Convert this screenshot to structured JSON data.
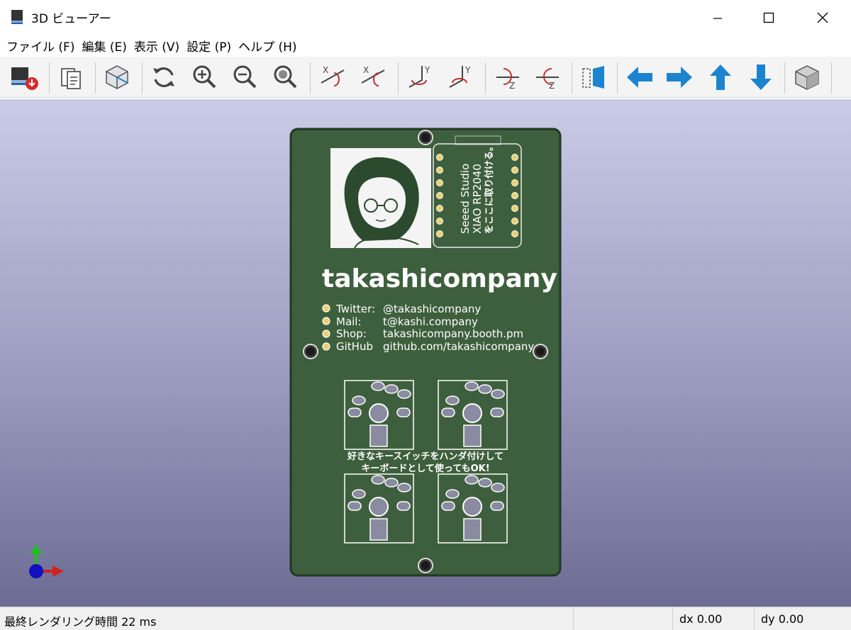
{
  "window": {
    "title": "3D ビューアー"
  },
  "menu": [
    "ファイル (F)",
    "編集 (E)",
    "表示 (V)",
    "設定 (P)",
    "ヘルプ (H)"
  ],
  "toolbar": {
    "buttons": [
      {
        "name": "render-raytracing",
        "icon": "board-render-icon"
      },
      {
        "name": "copy-image",
        "icon": "copy-icon"
      },
      {
        "name": "toggle-view",
        "icon": "view-box-icon"
      },
      {
        "name": "reload",
        "icon": "refresh-icon"
      },
      {
        "name": "zoom-in",
        "icon": "zoom-in-icon"
      },
      {
        "name": "zoom-out",
        "icon": "zoom-out-icon"
      },
      {
        "name": "zoom-fit",
        "icon": "zoom-fit-icon"
      },
      {
        "name": "rotate-x-cw",
        "icon": "rotate-x-cw-icon"
      },
      {
        "name": "rotate-x-ccw",
        "icon": "rotate-x-ccw-icon"
      },
      {
        "name": "rotate-y-cw",
        "icon": "rotate-y-cw-icon"
      },
      {
        "name": "rotate-y-ccw",
        "icon": "rotate-y-ccw-icon"
      },
      {
        "name": "rotate-z-cw",
        "icon": "rotate-z-cw-icon"
      },
      {
        "name": "rotate-z-ccw",
        "icon": "rotate-z-ccw-icon"
      },
      {
        "name": "flip-board",
        "icon": "flip-icon"
      },
      {
        "name": "move-left",
        "icon": "arrow-left-icon"
      },
      {
        "name": "move-right",
        "icon": "arrow-right-icon"
      },
      {
        "name": "move-up",
        "icon": "arrow-up-icon"
      },
      {
        "name": "move-down",
        "icon": "arrow-down-icon"
      },
      {
        "name": "orthographic",
        "icon": "cube-icon"
      }
    ]
  },
  "board": {
    "brand": "takashicompany",
    "module": [
      "Seeed Studio",
      "XIAO RP2040",
      "をここに取り付ける。"
    ],
    "contacts": [
      {
        "label": "Twitter:",
        "value": "@takashicompany"
      },
      {
        "label": "Mail:",
        "value": "t@kashi.company"
      },
      {
        "label": "Shop:",
        "value": "takashicompany.booth.pm"
      },
      {
        "label": "GitHub",
        "value": "github.com/takashicompany"
      }
    ],
    "note_line1": "好きなキースイッチをハンダ付けして",
    "note_line2": "キーボードとして使ってもOK!"
  },
  "colors": {
    "pcb": "#3e5f3d",
    "pcb_edge": "#213822",
    "accent_blue": "#1c83cf"
  },
  "status": {
    "render_time": "最終レンダリング時間 22 ms",
    "dx": "dx 0.00",
    "dy": "dy 0.00"
  }
}
